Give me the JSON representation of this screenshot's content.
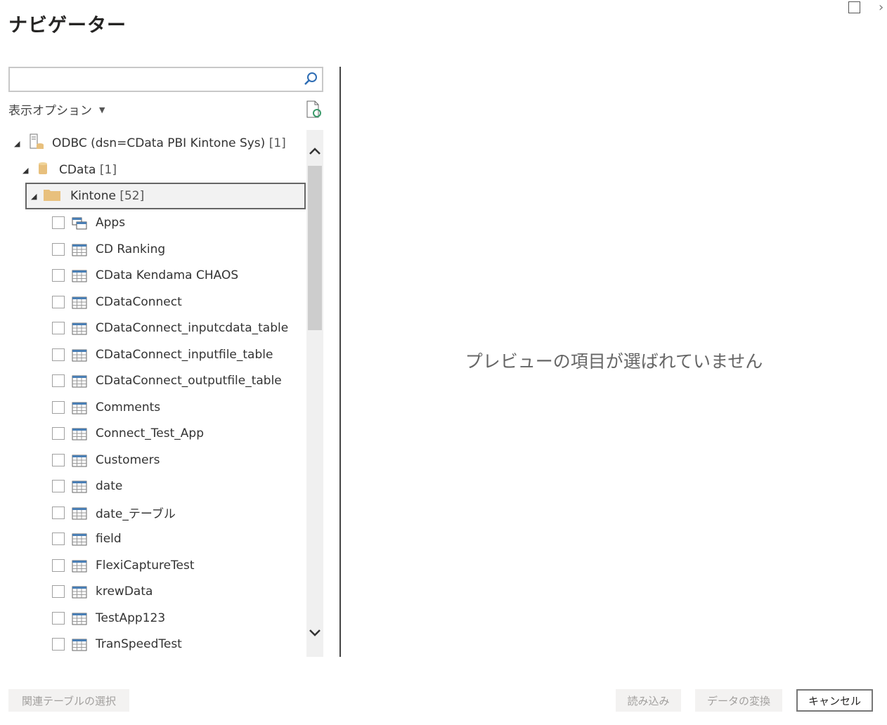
{
  "title": "ナビゲーター",
  "search": {
    "value": "",
    "placeholder": ""
  },
  "display_options": "表示オプション",
  "tree": {
    "odbc": {
      "label": "ODBC (dsn=CData PBI Kintone Sys)",
      "count": "[1]"
    },
    "catalog": {
      "label": "CData",
      "count": "[1]"
    },
    "schema": {
      "label": "Kintone",
      "count": "[52]"
    },
    "items": [
      "Apps",
      "CD Ranking",
      "CData Kendama CHAOS",
      "CDataConnect",
      "CDataConnect_inputcdata_table",
      "CDataConnect_inputfile_table",
      "CDataConnect_outputfile_table",
      "Comments",
      "Connect_Test_App",
      "Customers",
      "date",
      "date_テーブル",
      "field",
      "FlexiCaptureTest",
      "krewData",
      "TestApp123",
      "TranSpeedTest"
    ]
  },
  "preview_empty": "プレビューの項目が選ばれていません",
  "buttons": {
    "related": "関連テーブルの選択",
    "load": "読み込み",
    "transform": "データの変換",
    "cancel": "キャンセル"
  },
  "colors": {
    "accent": "#4a7fb5",
    "folder": "#e8c07d"
  }
}
